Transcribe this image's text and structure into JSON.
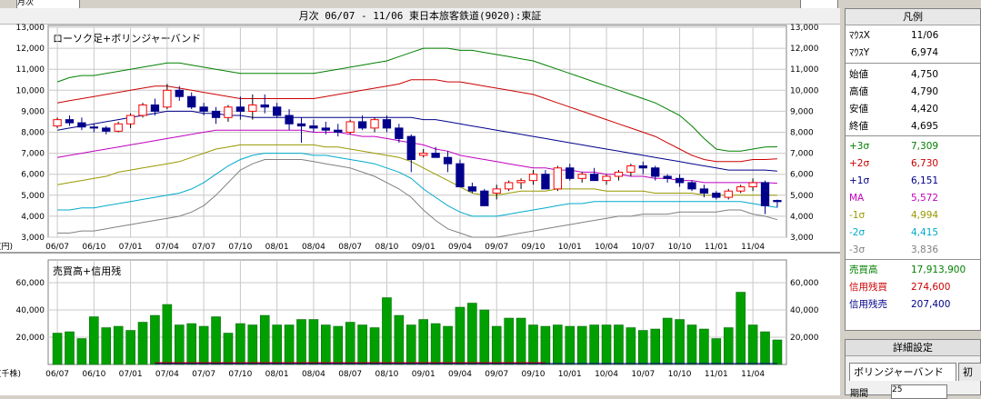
{
  "window": {
    "title": "月次 06/07 - 11/06   東日本旅客鉄道(9020):東証",
    "top_left_field": "月次"
  },
  "price_panel": {
    "label": "ローソク足+ボリンジャーバンド",
    "y_unit": "(円)",
    "y_ticks": [
      "3,000",
      "4,000",
      "5,000",
      "6,000",
      "7,000",
      "8,000",
      "9,000",
      "10,000",
      "11,000",
      "12,000",
      "13,000"
    ],
    "colors": {
      "up": "#ff0000",
      "down": "#00008b",
      "grid": "#c8c8c8"
    }
  },
  "volume_panel": {
    "label": "売買高+信用残",
    "y_unit": "(千株)",
    "y_ticks": [
      "20,000",
      "40,000",
      "60,000"
    ],
    "bar_color": "#00a000"
  },
  "x_axis_labels": [
    "06/07",
    "06/10",
    "07/01",
    "07/04",
    "07/07",
    "07/10",
    "08/01",
    "08/04",
    "08/07",
    "08/10",
    "09/01",
    "09/04",
    "09/07",
    "09/10",
    "10/01",
    "10/04",
    "10/07",
    "10/10",
    "11/01",
    "11/04"
  ],
  "chart_data": [
    {
      "type": "candlestick",
      "title": "ローソク足+ボリンジャーバンド",
      "ylabel": "(円)",
      "ylim": [
        3000,
        13000
      ],
      "x": [
        "06/07",
        "06/08",
        "06/09",
        "06/10",
        "06/11",
        "06/12",
        "07/01",
        "07/02",
        "07/03",
        "07/04",
        "07/05",
        "07/06",
        "07/07",
        "07/08",
        "07/09",
        "07/10",
        "07/11",
        "07/12",
        "08/01",
        "08/02",
        "08/03",
        "08/04",
        "08/05",
        "08/06",
        "08/07",
        "08/08",
        "08/09",
        "08/10",
        "08/11",
        "08/12",
        "09/01",
        "09/02",
        "09/03",
        "09/04",
        "09/05",
        "09/06",
        "09/07",
        "09/08",
        "09/09",
        "09/10",
        "09/11",
        "09/12",
        "10/01",
        "10/02",
        "10/03",
        "10/04",
        "10/05",
        "10/06",
        "10/07",
        "10/08",
        "10/09",
        "10/10",
        "10/11",
        "10/12",
        "11/01",
        "11/02",
        "11/03",
        "11/04",
        "11/05",
        "11/06"
      ],
      "ohlc": [
        [
          8300,
          8700,
          8200,
          8600
        ],
        [
          8600,
          8800,
          8300,
          8450
        ],
        [
          8450,
          8700,
          8100,
          8250
        ],
        [
          8250,
          8400,
          8000,
          8200
        ],
        [
          8200,
          8300,
          7900,
          8050
        ],
        [
          8050,
          8500,
          8000,
          8400
        ],
        [
          8400,
          8900,
          8200,
          8800
        ],
        [
          8800,
          9400,
          8700,
          9300
        ],
        [
          9300,
          9600,
          8800,
          9000
        ],
        [
          9200,
          10300,
          9100,
          10000
        ],
        [
          10000,
          10200,
          9500,
          9700
        ],
        [
          9700,
          9900,
          9100,
          9200
        ],
        [
          9200,
          9400,
          8800,
          9000
        ],
        [
          9000,
          9200,
          8400,
          8700
        ],
        [
          8700,
          9300,
          8500,
          9200
        ],
        [
          9200,
          9700,
          8600,
          9000
        ],
        [
          9000,
          9800,
          8600,
          9300
        ],
        [
          9300,
          9800,
          8900,
          9200
        ],
        [
          9200,
          9400,
          8700,
          8800
        ],
        [
          8800,
          9100,
          8100,
          8400
        ],
        [
          8400,
          8700,
          7500,
          8300
        ],
        [
          8300,
          8600,
          8000,
          8200
        ],
        [
          8200,
          8500,
          7900,
          8100
        ],
        [
          8100,
          8400,
          7800,
          8000
        ],
        [
          8000,
          8600,
          7900,
          8500
        ],
        [
          8500,
          8800,
          8100,
          8200
        ],
        [
          8200,
          8700,
          8000,
          8600
        ],
        [
          8600,
          8800,
          8000,
          8200
        ],
        [
          8200,
          8400,
          7500,
          7700
        ],
        [
          7800,
          7900,
          6100,
          6700
        ],
        [
          6900,
          7200,
          6800,
          7000
        ],
        [
          7000,
          7300,
          6900,
          6800
        ],
        [
          6800,
          7100,
          6100,
          6500
        ],
        [
          6500,
          6700,
          5800,
          5400
        ],
        [
          5400,
          5600,
          5100,
          5200
        ],
        [
          5200,
          5300,
          4500,
          4500
        ],
        [
          5100,
          5500,
          4800,
          5300
        ],
        [
          5300,
          5700,
          5200,
          5600
        ],
        [
          5600,
          5800,
          5300,
          5700
        ],
        [
          5700,
          6200,
          5500,
          6000
        ],
        [
          6000,
          6200,
          5400,
          5300
        ],
        [
          5300,
          6400,
          5200,
          6300
        ],
        [
          6300,
          6500,
          5700,
          5800
        ],
        [
          5800,
          6100,
          5600,
          6000
        ],
        [
          6000,
          6300,
          5800,
          5700
        ],
        [
          5700,
          6000,
          5500,
          5900
        ],
        [
          5900,
          6200,
          5700,
          6100
        ],
        [
          6100,
          6500,
          5900,
          6400
        ],
        [
          6400,
          6600,
          6000,
          6300
        ],
        [
          6300,
          6400,
          5700,
          5900
        ],
        [
          5900,
          6000,
          5600,
          5800
        ],
        [
          5800,
          6000,
          5400,
          5600
        ],
        [
          5600,
          5700,
          5200,
          5300
        ],
        [
          5300,
          5500,
          4900,
          5100
        ],
        [
          5100,
          5200,
          4800,
          4900
        ],
        [
          4900,
          5300,
          4800,
          5200
        ],
        [
          5200,
          5500,
          5100,
          5400
        ],
        [
          5400,
          5800,
          5200,
          5600
        ],
        [
          5600,
          5700,
          4100,
          4500
        ],
        [
          4750,
          4790,
          4420,
          4695
        ]
      ],
      "bands": {
        "plus3": [
          10400,
          10600,
          10700,
          10700,
          10800,
          10900,
          11000,
          11100,
          11200,
          11300,
          11300,
          11200,
          11100,
          11000,
          10900,
          10800,
          10800,
          10800,
          10800,
          10800,
          10800,
          10800,
          10900,
          11000,
          11100,
          11200,
          11300,
          11400,
          11600,
          11800,
          12000,
          12000,
          12000,
          11900,
          11900,
          11800,
          11700,
          11600,
          11500,
          11400,
          11200,
          11000,
          10800,
          10600,
          10400,
          10200,
          10000,
          9800,
          9600,
          9400,
          9100,
          8800,
          8300,
          7700,
          7200,
          7100,
          7100,
          7200,
          7300,
          7309
        ],
        "plus2": [
          9400,
          9500,
          9600,
          9700,
          9800,
          9900,
          10000,
          10100,
          10200,
          10200,
          10100,
          10000,
          9900,
          9800,
          9700,
          9600,
          9600,
          9600,
          9600,
          9600,
          9600,
          9600,
          9700,
          9800,
          9900,
          10000,
          10100,
          10200,
          10300,
          10500,
          10500,
          10500,
          10400,
          10400,
          10300,
          10200,
          10100,
          10000,
          9900,
          9800,
          9600,
          9400,
          9200,
          9000,
          8800,
          8600,
          8400,
          8200,
          8000,
          7800,
          7500,
          7200,
          6900,
          6700,
          6600,
          6600,
          6600,
          6700,
          6700,
          6730
        ],
        "plus1": [
          8100,
          8200,
          8300,
          8400,
          8500,
          8600,
          8700,
          8800,
          8900,
          9000,
          9000,
          9000,
          8900,
          8900,
          8800,
          8800,
          8700,
          8700,
          8700,
          8700,
          8700,
          8700,
          8700,
          8700,
          8700,
          8700,
          8700,
          8700,
          8700,
          8700,
          8600,
          8600,
          8500,
          8400,
          8300,
          8200,
          8100,
          8000,
          7900,
          7800,
          7700,
          7600,
          7500,
          7400,
          7300,
          7200,
          7100,
          7000,
          6900,
          6800,
          6700,
          6600,
          6500,
          6400,
          6300,
          6200,
          6200,
          6200,
          6200,
          6151
        ],
        "ma": [
          6800,
          6900,
          7000,
          7100,
          7200,
          7300,
          7400,
          7500,
          7600,
          7700,
          7800,
          7900,
          8000,
          8100,
          8100,
          8100,
          8100,
          8100,
          8100,
          8100,
          8100,
          8000,
          8000,
          8000,
          7900,
          7800,
          7800,
          7700,
          7600,
          7500,
          7400,
          7200,
          7100,
          6900,
          6800,
          6700,
          6600,
          6500,
          6400,
          6300,
          6300,
          6200,
          6200,
          6100,
          6100,
          6000,
          6000,
          5900,
          5900,
          5800,
          5800,
          5700,
          5700,
          5600,
          5600,
          5600,
          5600,
          5600,
          5600,
          5572
        ],
        "minus1": [
          5500,
          5600,
          5700,
          5800,
          5900,
          6100,
          6200,
          6300,
          6400,
          6500,
          6600,
          6800,
          7000,
          7200,
          7300,
          7400,
          7400,
          7400,
          7400,
          7400,
          7400,
          7400,
          7300,
          7300,
          7200,
          7100,
          7000,
          6900,
          6800,
          6600,
          6300,
          6000,
          5700,
          5400,
          5100,
          5000,
          5000,
          5100,
          5200,
          5200,
          5200,
          5300,
          5300,
          5300,
          5300,
          5200,
          5200,
          5200,
          5200,
          5100,
          5100,
          5100,
          5100,
          5000,
          5000,
          5000,
          5000,
          5000,
          5000,
          4994
        ],
        "minus2": [
          4300,
          4300,
          4400,
          4400,
          4500,
          4600,
          4700,
          4800,
          4900,
          5000,
          5100,
          5300,
          5600,
          6000,
          6400,
          6700,
          6900,
          7000,
          7000,
          7000,
          7000,
          6900,
          6900,
          6800,
          6700,
          6600,
          6500,
          6300,
          6100,
          5800,
          5300,
          4900,
          4500,
          4200,
          4000,
          4000,
          4000,
          4100,
          4200,
          4300,
          4400,
          4500,
          4600,
          4600,
          4700,
          4700,
          4700,
          4700,
          4700,
          4700,
          4700,
          4700,
          4700,
          4700,
          4700,
          4700,
          4700,
          4600,
          4500,
          4415
        ],
        "minus3": [
          3200,
          3200,
          3300,
          3300,
          3400,
          3500,
          3600,
          3700,
          3800,
          3900,
          4000,
          4200,
          4500,
          5000,
          5600,
          6200,
          6500,
          6700,
          6700,
          6700,
          6700,
          6600,
          6500,
          6400,
          6300,
          6100,
          5900,
          5600,
          5300,
          4900,
          4300,
          3800,
          3400,
          3200,
          3000,
          3000,
          3000,
          3100,
          3200,
          3300,
          3400,
          3500,
          3600,
          3700,
          3800,
          3900,
          4000,
          4000,
          4100,
          4100,
          4100,
          4200,
          4200,
          4200,
          4200,
          4300,
          4300,
          4100,
          4000,
          3836
        ]
      },
      "band_colors": {
        "plus3": "#008000",
        "plus2": "#cc0000",
        "plus1": "#00008b",
        "ma": "#c000c0",
        "minus1": "#999900",
        "minus2": "#00aacc",
        "minus3": "#808080"
      }
    },
    {
      "type": "bar",
      "title": "売買高+信用残",
      "ylabel": "(千株)",
      "ylim": [
        0,
        70000
      ],
      "x": [
        "06/07",
        "06/08",
        "06/09",
        "06/10",
        "06/11",
        "06/12",
        "07/01",
        "07/02",
        "07/03",
        "07/04",
        "07/05",
        "07/06",
        "07/07",
        "07/08",
        "07/09",
        "07/10",
        "07/11",
        "07/12",
        "08/01",
        "08/02",
        "08/03",
        "08/04",
        "08/05",
        "08/06",
        "08/07",
        "08/08",
        "08/09",
        "08/10",
        "08/11",
        "08/12",
        "09/01",
        "09/02",
        "09/03",
        "09/04",
        "09/05",
        "09/06",
        "09/07",
        "09/08",
        "09/09",
        "09/10",
        "09/11",
        "09/12",
        "10/01",
        "10/02",
        "10/03",
        "10/04",
        "10/05",
        "10/06",
        "10/07",
        "10/08",
        "10/09",
        "10/10",
        "10/11",
        "10/12",
        "11/01",
        "11/02",
        "11/03",
        "11/04",
        "11/05",
        "11/06"
      ],
      "values": [
        23000,
        24000,
        19000,
        35000,
        27000,
        28000,
        25000,
        31000,
        36000,
        44000,
        29000,
        30000,
        28000,
        35000,
        23000,
        30000,
        29000,
        36000,
        29000,
        29000,
        33000,
        33000,
        29000,
        28000,
        31000,
        29000,
        27000,
        49000,
        36000,
        29000,
        33000,
        30000,
        28000,
        42000,
        45000,
        40000,
        28000,
        34000,
        34000,
        29000,
        28000,
        29000,
        28000,
        28000,
        29000,
        29000,
        29000,
        27000,
        25000,
        26000,
        34000,
        33000,
        29000,
        26000,
        19000,
        27000,
        53000,
        29000,
        24000,
        18000
      ]
    }
  ],
  "legend": {
    "header": "凡例",
    "rows": [
      {
        "k": "ﾏｳｽX",
        "v": "11/06",
        "color": "#000000"
      },
      {
        "k": "ﾏｳｽY",
        "v": "6,974",
        "color": "#000000"
      },
      {
        "k": "始値",
        "v": "4,750",
        "color": "#000000"
      },
      {
        "k": "高値",
        "v": "4,790",
        "color": "#000000"
      },
      {
        "k": "安値",
        "v": "4,420",
        "color": "#000000"
      },
      {
        "k": "終値",
        "v": "4,695",
        "color": "#000000"
      },
      {
        "k": "+3σ",
        "v": "7,309",
        "color": "#008000"
      },
      {
        "k": "+2σ",
        "v": "6,730",
        "color": "#cc0000"
      },
      {
        "k": "+1σ",
        "v": "6,151",
        "color": "#00008b"
      },
      {
        "k": "MA",
        "v": "5,572",
        "color": "#c000c0"
      },
      {
        "k": "-1σ",
        "v": "4,994",
        "color": "#999900"
      },
      {
        "k": "-2σ",
        "v": "4,415",
        "color": "#00aacc"
      },
      {
        "k": "-3σ",
        "v": "3,836",
        "color": "#808080"
      },
      {
        "k": "売買高",
        "v": "17,913,900",
        "color": "#008000"
      },
      {
        "k": "信用残買",
        "v": "274,600",
        "color": "#cc0000"
      },
      {
        "k": "信用残売",
        "v": "207,400",
        "color": "#00008b"
      }
    ]
  },
  "detail": {
    "header": "詳細設定",
    "tab_active": "ボリンジャーバンド",
    "tab_other": "初期",
    "period_label": "期間",
    "period_value": "25"
  }
}
